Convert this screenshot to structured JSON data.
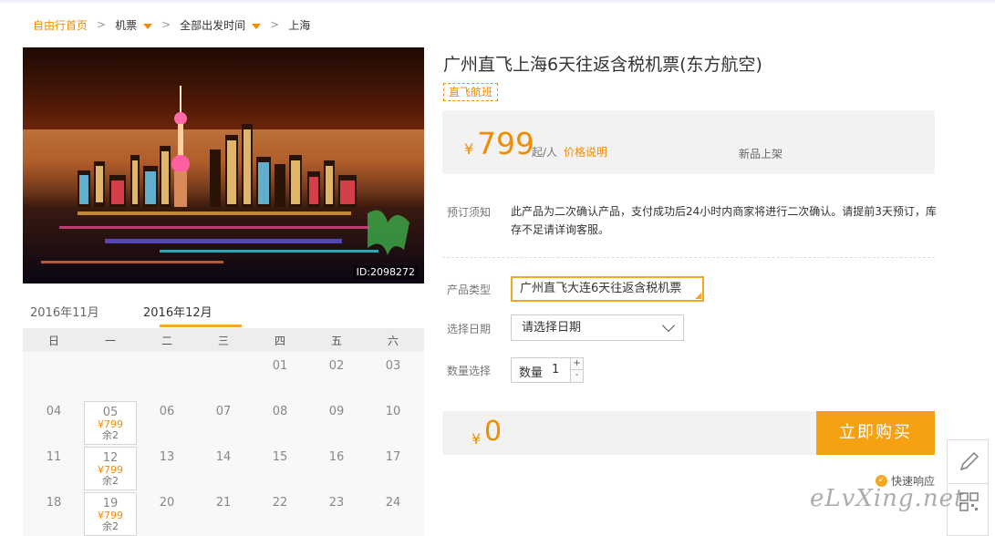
{
  "breadcrumb": {
    "home": "自由行首页",
    "category": "机票",
    "time": "全部出发时间",
    "city": "上海"
  },
  "hero": {
    "id_label": "ID:2098272"
  },
  "calendar": {
    "months": [
      "2016年11月",
      "2016年12月"
    ],
    "active_month": "2016年12月",
    "weekdays": [
      "日",
      "一",
      "二",
      "三",
      "四",
      "五",
      "六"
    ],
    "weeks": [
      [
        {
          "d": ""
        },
        {
          "d": ""
        },
        {
          "d": ""
        },
        {
          "d": ""
        },
        {
          "d": "01"
        },
        {
          "d": "02"
        },
        {
          "d": "03"
        }
      ],
      [
        {
          "d": "04"
        },
        {
          "d": "05",
          "price": "¥799",
          "stock": "余2"
        },
        {
          "d": "06"
        },
        {
          "d": "07"
        },
        {
          "d": "08"
        },
        {
          "d": "09"
        },
        {
          "d": "10"
        }
      ],
      [
        {
          "d": "11"
        },
        {
          "d": "12",
          "price": "¥799",
          "stock": "余2"
        },
        {
          "d": "13"
        },
        {
          "d": "14"
        },
        {
          "d": "15"
        },
        {
          "d": "16"
        },
        {
          "d": "17"
        }
      ],
      [
        {
          "d": "18"
        },
        {
          "d": "19",
          "price": "¥799",
          "stock": "余2"
        },
        {
          "d": "20"
        },
        {
          "d": "21"
        },
        {
          "d": "22"
        },
        {
          "d": "23"
        },
        {
          "d": "24"
        }
      ]
    ]
  },
  "product": {
    "title": "广州直飞上海6天往返含税机票(东方航空)",
    "badge": "直飞航班",
    "currency": "¥",
    "price": "799",
    "per_person": "起/人",
    "price_note_link": "价格说明",
    "new_tag": "新品上架",
    "notice_label": "预订须知",
    "notice_text": "此产品为二次确认产品，支付成功后24小时内商家将进行二次确认。请提前3天预订，库存不足请详询客服。",
    "type_label": "产品类型",
    "type_value": "广州直飞大连6天往返含税机票",
    "date_label": "选择日期",
    "date_placeholder": "请选择日期",
    "qty_label": "数量选择",
    "qty_field_label": "数量",
    "qty_value": "1",
    "qty_plus": "+",
    "qty_minus": "-",
    "total_currency": "¥",
    "total": "0",
    "buy_label": "立即购买",
    "quick_response": "快速响应"
  },
  "watermark": "eLvXing.net",
  "colors": {
    "accent": "#f08c00",
    "button": "#f5a111"
  }
}
